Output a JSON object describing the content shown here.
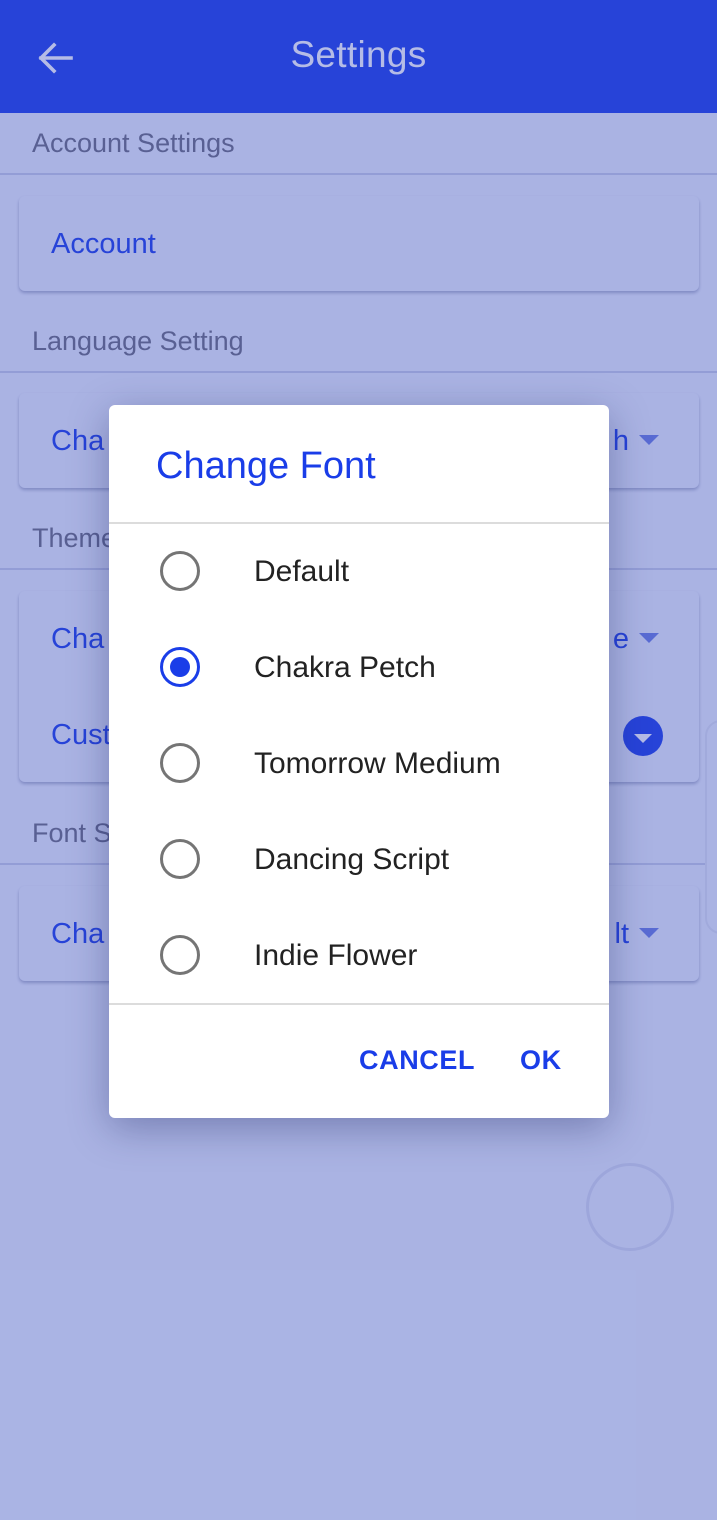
{
  "app_bar": {
    "title": "Settings",
    "back_icon": "arrow-left-icon"
  },
  "sections": {
    "account": {
      "header": "Account Settings",
      "item_label": "Account"
    },
    "language": {
      "header": "Language Setting",
      "item_label": "Cha",
      "item_value": "h"
    },
    "theme": {
      "header": "Theme",
      "item_label": "Cha",
      "item_value": "e",
      "custom_label": "Cust"
    },
    "font": {
      "header": "Font S",
      "item_label": "Cha",
      "item_value": "lt"
    }
  },
  "dialog": {
    "title": "Change Font",
    "options": [
      {
        "label": "Default",
        "selected": false
      },
      {
        "label": "Chakra Petch",
        "selected": true
      },
      {
        "label": "Tomorrow Medium",
        "selected": false
      },
      {
        "label": "Dancing Script",
        "selected": false
      },
      {
        "label": "Indie Flower",
        "selected": false
      }
    ],
    "cancel_label": "CANCEL",
    "ok_label": "OK"
  },
  "colors": {
    "primary": "#1a3de8",
    "scrim": "rgba(60,80,190,0.38)"
  }
}
